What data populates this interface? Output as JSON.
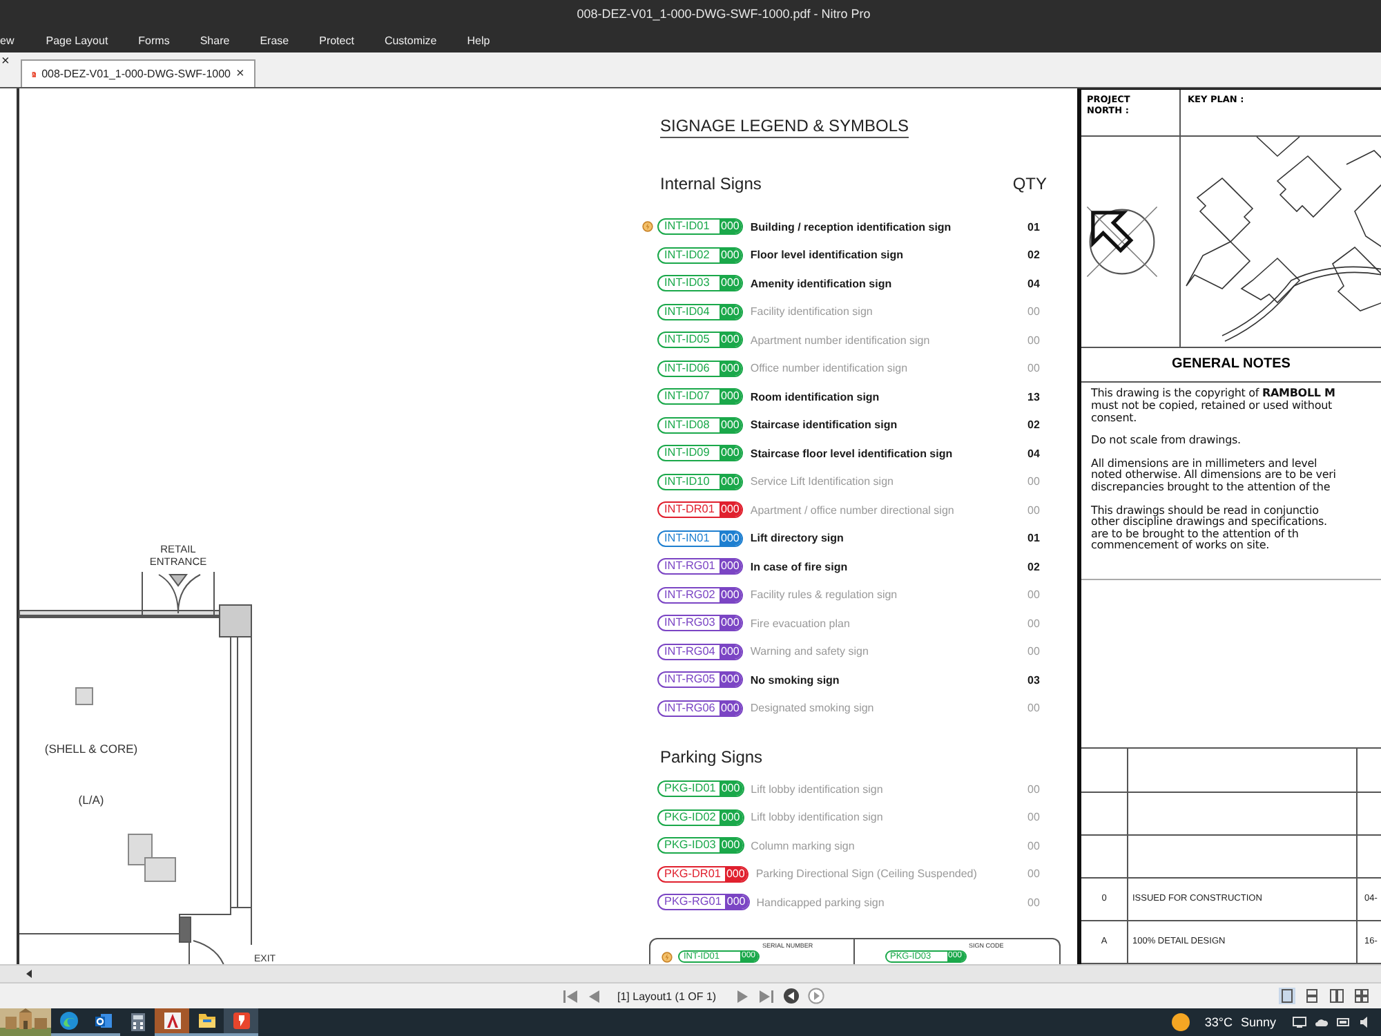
{
  "window": {
    "title": "008-DEZ-V01_1-000-DWG-SWF-1000.pdf - Nitro Pro"
  },
  "menu": [
    "ew",
    "Page Layout",
    "Forms",
    "Share",
    "Erase",
    "Protect",
    "Customize",
    "Help"
  ],
  "panel_close": "×",
  "tabs": [
    {
      "label": "008-DEZ-V01_1-000-DWG-SWF-1000",
      "close": "×",
      "selected": true
    }
  ],
  "plan": {
    "entrance": [
      "RETAIL",
      "ENTRANCE"
    ],
    "area": "(SHELL & CORE)",
    "code": "(L/A)",
    "exit": "EXIT"
  },
  "legend": {
    "title": "SIGNAGE LEGEND & SYMBOLS",
    "sections": [
      {
        "heading": "Internal Signs",
        "qty_heading": "QTY",
        "rows": [
          {
            "code": "INT-ID01",
            "number": "000",
            "description": "Building / reception identification sign",
            "qty": "01",
            "color": "#1aa84a",
            "dimmed": false,
            "flagged": true
          },
          {
            "code": "INT-ID02",
            "number": "000",
            "description": "Floor level identification sign",
            "qty": "02",
            "color": "#1aa84a",
            "dimmed": false,
            "flagged": false
          },
          {
            "code": "INT-ID03",
            "number": "000",
            "description": "Amenity identification sign",
            "qty": "04",
            "color": "#1aa84a",
            "dimmed": false,
            "flagged": false
          },
          {
            "code": "INT-ID04",
            "number": "000",
            "description": "Facility identification sign",
            "qty": "00",
            "color": "#1aa84a",
            "dimmed": true,
            "flagged": false
          },
          {
            "code": "INT-ID05",
            "number": "000",
            "description": "Apartment number identification sign",
            "qty": "00",
            "color": "#1aa84a",
            "dimmed": true,
            "flagged": false
          },
          {
            "code": "INT-ID06",
            "number": "000",
            "description": "Office number identification sign",
            "qty": "00",
            "color": "#1aa84a",
            "dimmed": true,
            "flagged": false
          },
          {
            "code": "INT-ID07",
            "number": "000",
            "description": "Room identification sign",
            "qty": "13",
            "color": "#1aa84a",
            "dimmed": false,
            "flagged": false
          },
          {
            "code": "INT-ID08",
            "number": "000",
            "description": "Staircase identification sign",
            "qty": "02",
            "color": "#1aa84a",
            "dimmed": false,
            "flagged": false
          },
          {
            "code": "INT-ID09",
            "number": "000",
            "description": "Staircase floor level identification sign",
            "qty": "04",
            "color": "#1aa84a",
            "dimmed": false,
            "flagged": false
          },
          {
            "code": "INT-ID10",
            "number": "000",
            "description": "Service Lift Identification sign",
            "qty": "00",
            "color": "#1aa84a",
            "dimmed": true,
            "flagged": false
          },
          {
            "code": "INT-DR01",
            "number": "000",
            "description": "Apartment / office number directional sign",
            "qty": "00",
            "color": "#e0202e",
            "dimmed": true,
            "flagged": false
          },
          {
            "code": "INT-IN01",
            "number": "000",
            "description": "Lift directory sign",
            "qty": "01",
            "color": "#1e7fd0",
            "dimmed": false,
            "flagged": false
          },
          {
            "code": "INT-RG01",
            "number": "000",
            "description": "In case of fire sign",
            "qty": "02",
            "color": "#7b45c4",
            "dimmed": false,
            "flagged": false
          },
          {
            "code": "INT-RG02",
            "number": "000",
            "description": "Facility rules & regulation sign",
            "qty": "00",
            "color": "#7b45c4",
            "dimmed": true,
            "flagged": false
          },
          {
            "code": "INT-RG03",
            "number": "000",
            "description": "Fire evacuation plan",
            "qty": "00",
            "color": "#7b45c4",
            "dimmed": true,
            "flagged": false
          },
          {
            "code": "INT-RG04",
            "number": "000",
            "description": "Warning and safety sign",
            "qty": "00",
            "color": "#7b45c4",
            "dimmed": true,
            "flagged": false
          },
          {
            "code": "INT-RG05",
            "number": "000",
            "description": "No smoking sign",
            "qty": "03",
            "color": "#7b45c4",
            "dimmed": false,
            "flagged": false
          },
          {
            "code": "INT-RG06",
            "number": "000",
            "description": "Designated smoking sign",
            "qty": "00",
            "color": "#7b45c4",
            "dimmed": true,
            "flagged": false
          }
        ]
      },
      {
        "heading": "Parking Signs",
        "rows": [
          {
            "code": "PKG-ID01",
            "number": "000",
            "description": "Lift lobby identification sign",
            "qty": "00",
            "color": "#1aa84a",
            "dimmed": true,
            "flagged": false
          },
          {
            "code": "PKG-ID02",
            "number": "000",
            "description": "Lift lobby identification sign",
            "qty": "00",
            "color": "#1aa84a",
            "dimmed": true,
            "flagged": false
          },
          {
            "code": "PKG-ID03",
            "number": "000",
            "description": "Column marking sign",
            "qty": "00",
            "color": "#1aa84a",
            "dimmed": true,
            "flagged": false
          },
          {
            "code": "PKG-DR01",
            "number": "000",
            "description": "Parking Directional Sign (Ceiling Suspended)",
            "qty": "00",
            "color": "#e0202e",
            "dimmed": true,
            "flagged": false
          },
          {
            "code": "PKG-RG01",
            "number": "000",
            "description": "Handicapped parking sign",
            "qty": "00",
            "color": "#7b45c4",
            "dimmed": true,
            "flagged": false
          }
        ]
      }
    ],
    "key": [
      {
        "code": "INT-ID01",
        "number": "000",
        "color": "#1aa84a",
        "flagged": true,
        "callout": "SERIAL NUMBER"
      },
      {
        "code": "PKG-ID03",
        "number": "000",
        "color": "#1aa84a",
        "flagged": false,
        "callout": "SIGN CODE"
      }
    ]
  },
  "title_block": {
    "north_label": "PROJECT NORTH :",
    "key_plan_label": "KEY PLAN :",
    "notes_title": "GENERAL NOTES",
    "notes": [
      [
        "This drawing is the copyright of **RAMBOLL M**",
        "must not be copied, retained or used without",
        "consent."
      ],
      [
        "Do not scale from drawings."
      ],
      [
        "All dimensions are in millimeters and level",
        "noted otherwise. All dimensions are to be veri",
        "discrepancies brought to the attention of the"
      ],
      [
        "This drawings should be read in conjunctio",
        "other discipline drawings and specifications.",
        "are to be brought to the attention of th",
        "commencement of works on site."
      ]
    ],
    "revisions": [
      {
        "rev": "0",
        "description": "ISSUED FOR CONSTRUCTION",
        "date": "04-"
      },
      {
        "rev": "A",
        "description": "100% DETAIL DESIGN",
        "date": "16-"
      }
    ]
  },
  "nav": {
    "page_label": "[1] Layout1 (1 OF 1)"
  },
  "taskbar": {
    "apps": [
      {
        "kind": "edge",
        "running": true,
        "selected": false
      },
      {
        "kind": "outlook",
        "running": true,
        "selected": false
      },
      {
        "kind": "calculator",
        "running": false,
        "selected": false
      },
      {
        "kind": "autocad",
        "running": true,
        "selected": false
      },
      {
        "kind": "folder",
        "running": true,
        "selected": false
      },
      {
        "kind": "nitro",
        "running": true,
        "selected": true
      }
    ],
    "weather": {
      "temp": "33°C",
      "condition": "Sunny"
    }
  }
}
